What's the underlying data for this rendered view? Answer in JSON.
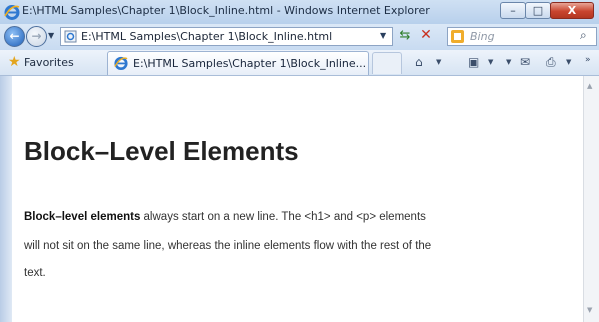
{
  "window": {
    "title": "E:\\HTML Samples\\Chapter 1\\Block_Inline.html - Windows Internet Explorer",
    "minimize": "–",
    "maximize": "□",
    "close": "X"
  },
  "address_bar": {
    "url": "E:\\HTML Samples\\Chapter 1\\Block_Inline.html",
    "refresh": "⇆",
    "stop": "✕"
  },
  "search": {
    "placeholder": "Bing",
    "go": "⌕"
  },
  "favorites_bar": {
    "label": "Favorites",
    "tab_label": "E:\\HTML Samples\\Chapter 1\\Block_Inline...",
    "more": "»"
  },
  "page": {
    "heading": "Block–Level Elements",
    "p1_bold": "Block–level elements",
    "p1_rest": " always start on a new line. The <h1> and <p> elements",
    "p2": "will not sit on the same line, whereas the inline elements flow with the rest of the",
    "p3": "text."
  },
  "colors": {
    "chrome": "#dfe9f5",
    "close_button": "#c9452f",
    "content_bg": "#ffffff"
  },
  "icons": [
    "ie-logo-icon",
    "back-arrow-icon",
    "forward-arrow-icon",
    "page-icon",
    "refresh-icon",
    "stop-icon",
    "bing-icon",
    "search-icon",
    "favorites-star-icon",
    "home-icon",
    "feed-icon",
    "mail-icon",
    "print-icon"
  ]
}
